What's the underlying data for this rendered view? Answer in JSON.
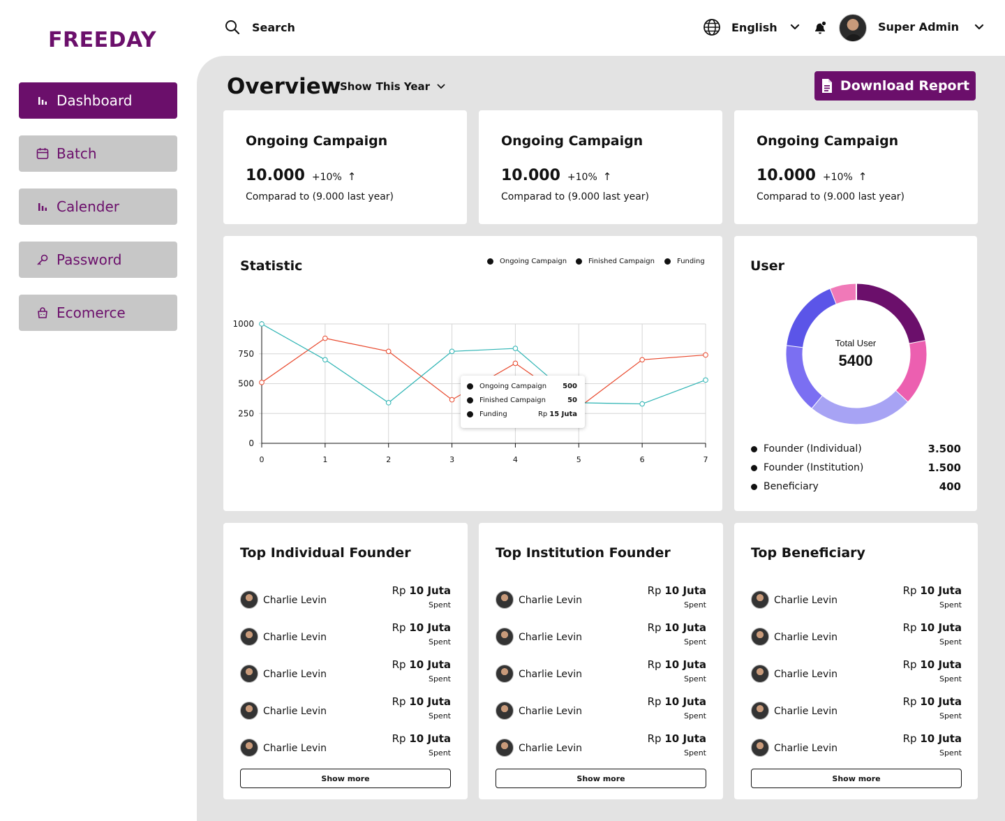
{
  "brand": "FREEDAY",
  "sidebar": {
    "items": [
      {
        "label": "Dashboard",
        "icon": "bar-chart-icon"
      },
      {
        "label": "Batch",
        "icon": "calendar-icon"
      },
      {
        "label": "Calender",
        "icon": "bar-chart-icon"
      },
      {
        "label": "Password",
        "icon": "key-icon"
      },
      {
        "label": "Ecomerce",
        "icon": "shopping-bag-icon"
      }
    ]
  },
  "topbar": {
    "search_label": "Search",
    "language": "English",
    "user_name": "Super Admin"
  },
  "overview": {
    "title": "Overview",
    "filter_prefix": "Show",
    "filter_value": "This Year",
    "download_label": "Download Report"
  },
  "kpis": [
    {
      "title": "Ongoing Campaign",
      "value": "10.000",
      "change": "+10%",
      "arrow": "↑",
      "compare": "Comparad to (9.000 last year)"
    },
    {
      "title": "Ongoing Campaign",
      "value": "10.000",
      "change": "+10%",
      "arrow": "↑",
      "compare": "Comparad to (9.000 last year)"
    },
    {
      "title": "Ongoing Campaign",
      "value": "10.000",
      "change": "+10%",
      "arrow": "↑",
      "compare": "Comparad to (9.000 last year)"
    }
  ],
  "statistic": {
    "title": "Statistic",
    "legend": [
      "Ongoing Campaign",
      "Finished Campaign",
      "Funding"
    ],
    "tooltip": [
      {
        "label": "Ongoing Campaign",
        "value": "500"
      },
      {
        "label": "Finished Campaign",
        "value": "50"
      },
      {
        "label": "Funding",
        "value_prefix": "Rp",
        "value": "15 Juta"
      }
    ]
  },
  "chart_data": {
    "type": "line",
    "x": [
      0,
      1,
      2,
      3,
      4,
      5,
      6,
      7
    ],
    "ylim": [
      0,
      1000
    ],
    "yticks": [
      0,
      250,
      500,
      750,
      1000
    ],
    "grid": true,
    "series": [
      {
        "color": "#e8462a",
        "values": [
          510,
          880,
          770,
          365,
          670,
          300,
          700,
          740
        ]
      },
      {
        "color": "#2bb3b3",
        "values": [
          1000,
          700,
          340,
          770,
          795,
          340,
          330,
          530
        ]
      }
    ]
  },
  "user": {
    "title": "User",
    "total_label": "Total User",
    "total_value": "5400",
    "legend": [
      {
        "label": "Founder (Individual)",
        "value": "3.500"
      },
      {
        "label": "Founder (Institution)",
        "value": "1.500"
      },
      {
        "label": "Beneficiary",
        "value": "400"
      }
    ],
    "segments": [
      {
        "color": "#6b0f6b",
        "fraction": 0.22
      },
      {
        "color": "#ec5fb0",
        "fraction": 0.15
      },
      {
        "color": "#a7a3f4",
        "fraction": 0.24
      },
      {
        "color": "#7b6ff2",
        "fraction": 0.16
      },
      {
        "color": "#5b55e8",
        "fraction": 0.17
      },
      {
        "color": "#f079b8",
        "fraction": 0.06
      }
    ]
  },
  "lists": [
    {
      "title": "Top Individual Founder",
      "rows": [
        {
          "name": "Charlie Levin",
          "prefix": "Rp",
          "amount": "10 Juta",
          "note": "Spent"
        },
        {
          "name": "Charlie Levin",
          "prefix": "Rp",
          "amount": "10 Juta",
          "note": "Spent"
        },
        {
          "name": "Charlie Levin",
          "prefix": "Rp",
          "amount": "10 Juta",
          "note": "Spent"
        },
        {
          "name": "Charlie Levin",
          "prefix": "Rp",
          "amount": "10 Juta",
          "note": "Spent"
        },
        {
          "name": "Charlie Levin",
          "prefix": "Rp",
          "amount": "10 Juta",
          "note": "Spent"
        }
      ],
      "button": "Show more"
    },
    {
      "title": "Top Institution Founder",
      "rows": [
        {
          "name": "Charlie Levin",
          "prefix": "Rp",
          "amount": "10 Juta",
          "note": "Spent"
        },
        {
          "name": "Charlie Levin",
          "prefix": "Rp",
          "amount": "10 Juta",
          "note": "Spent"
        },
        {
          "name": "Charlie Levin",
          "prefix": "Rp",
          "amount": "10 Juta",
          "note": "Spent"
        },
        {
          "name": "Charlie Levin",
          "prefix": "Rp",
          "amount": "10 Juta",
          "note": "Spent"
        },
        {
          "name": "Charlie Levin",
          "prefix": "Rp",
          "amount": "10 Juta",
          "note": "Spent"
        }
      ],
      "button": "Show more"
    },
    {
      "title": "Top Beneficiary",
      "rows": [
        {
          "name": "Charlie Levin",
          "prefix": "Rp",
          "amount": "10 Juta",
          "note": "Spent"
        },
        {
          "name": "Charlie Levin",
          "prefix": "Rp",
          "amount": "10 Juta",
          "note": "Spent"
        },
        {
          "name": "Charlie Levin",
          "prefix": "Rp",
          "amount": "10 Juta",
          "note": "Spent"
        },
        {
          "name": "Charlie Levin",
          "prefix": "Rp",
          "amount": "10 Juta",
          "note": "Spent"
        },
        {
          "name": "Charlie Levin",
          "prefix": "Rp",
          "amount": "10 Juta",
          "note": "Spent"
        }
      ],
      "button": "Show more"
    }
  ],
  "colors": {
    "brand": "#6b0f6b",
    "sidebar_inactive": "#c7c7c7",
    "main_bg": "#e3e3e3"
  }
}
